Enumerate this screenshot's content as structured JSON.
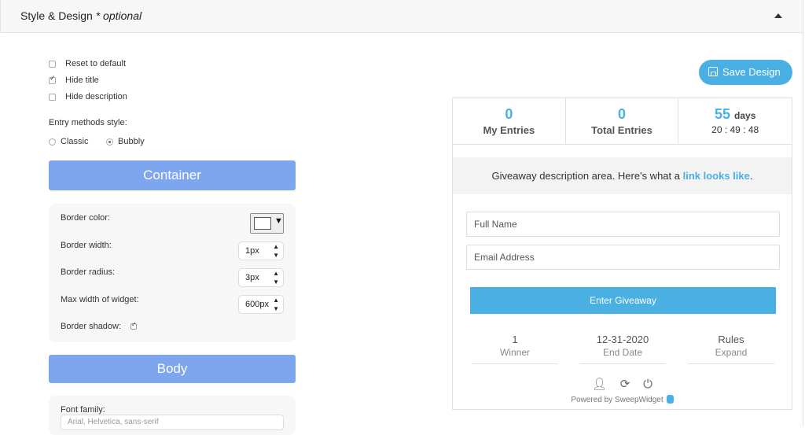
{
  "header": {
    "title": "Style & Design",
    "optional": "* optional"
  },
  "options": {
    "reset_label": "Reset to default",
    "hide_title_label": "Hide title",
    "hide_description_label": "Hide description",
    "entry_methods_label": "Entry methods style:",
    "classic_label": "Classic",
    "bubbly_label": "Bubbly",
    "hide_title_checked": true,
    "selected_style": "Bubbly"
  },
  "container": {
    "heading": "Container",
    "border_color_label": "Border color:",
    "border_width_label": "Border width:",
    "border_width_value": "1px",
    "border_radius_label": "Border radius:",
    "border_radius_value": "3px",
    "max_width_label": "Max width of widget:",
    "max_width_value": "600px",
    "border_shadow_label": "Border shadow:"
  },
  "body_section": {
    "heading": "Body",
    "font_family_label": "Font family:",
    "font_family_value": "Arial, Helvetica, sans-serif"
  },
  "save_button": {
    "label": "Save Design",
    "icon": "floppy-disk-icon"
  },
  "widget": {
    "my_entries_count": "0",
    "my_entries_label": "My Entries",
    "total_entries_count": "0",
    "total_entries_label": "Total Entries",
    "days_count": "55",
    "days_label": "days",
    "countdown": "20 : 49 : 48",
    "description_text": "Giveaway description area. Here's what a",
    "description_link": "link looks like",
    "description_end": ".",
    "full_name_placeholder": "Full Name",
    "email_placeholder": "Email Address",
    "enter_button": "Enter Giveaway",
    "winners_value": "1",
    "winners_label": "Winner",
    "end_date_value": "12-31-2020",
    "end_date_label": "End Date",
    "rules_value": "Rules",
    "rules_label": "Expand",
    "powered_by": "Powered by SweepWidget"
  },
  "colors": {
    "accent": "#4ab0e4",
    "section_button": "#7ea6ee",
    "panel_bg": "#f7f7f7"
  }
}
